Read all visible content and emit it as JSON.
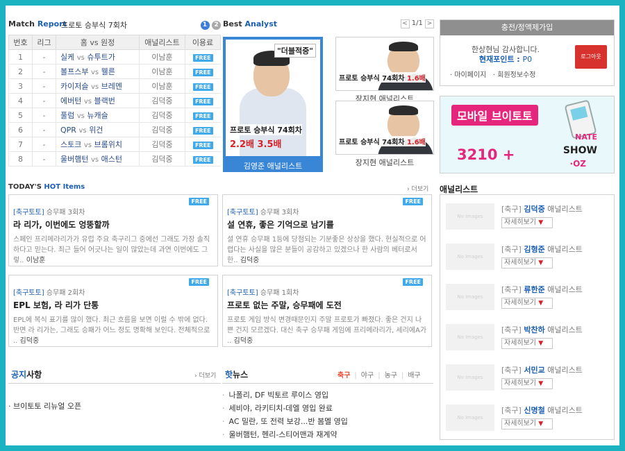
{
  "match_report": {
    "title_a": "Match",
    "title_b": "Report",
    "subtitle": "프로토 승부식 7회차",
    "pages": [
      "1",
      "2"
    ],
    "headers": [
      "번호",
      "리그",
      "홈 vs 원정",
      "애널리스트",
      "이용료"
    ],
    "rows": [
      {
        "no": "1",
        "league": "-",
        "home": "실케",
        "away": "슈투트가",
        "analyst": "이남훈",
        "fee": "FREE"
      },
      {
        "no": "2",
        "league": "-",
        "home": "볼프스부",
        "away": "웰른",
        "analyst": "이남훈",
        "fee": "FREE"
      },
      {
        "no": "3",
        "league": "-",
        "home": "카이저슬",
        "away": "브레멘",
        "analyst": "이남훈",
        "fee": "FREE"
      },
      {
        "no": "4",
        "league": "-",
        "home": "에버턴",
        "away": "블랙번",
        "analyst": "김덕중",
        "fee": "FREE"
      },
      {
        "no": "5",
        "league": "-",
        "home": "풀럼",
        "away": "뉴캐슬",
        "analyst": "김덕중",
        "fee": "FREE"
      },
      {
        "no": "6",
        "league": "-",
        "home": "QPR",
        "away": "위건",
        "analyst": "김덕중",
        "fee": "FREE"
      },
      {
        "no": "7",
        "league": "-",
        "home": "스토크",
        "away": "브롬위치",
        "analyst": "김덕중",
        "fee": "FREE"
      },
      {
        "no": "8",
        "league": "-",
        "home": "울버햄턴",
        "away": "애스턴",
        "analyst": "김덕중",
        "fee": "FREE"
      }
    ],
    "vs": "vs"
  },
  "best_analyst": {
    "title_a": "Best",
    "title_b": "Analyst",
    "pager": "1/1",
    "prev": "<",
    "next": ">",
    "featured": {
      "quote": "\"더블적중\"",
      "line1": "프로토 승부식 74회차",
      "line2": "2.2배 3.5배",
      "name": "김영준 애널리스트"
    },
    "small": [
      {
        "line": "프로토 승부식 74회차",
        "mult": "1.6배",
        "name": "장지현 애널리스트"
      },
      {
        "line": "프로토 승부식 74회차",
        "mult": "1.6배",
        "name": "장지현 애널리스트"
      }
    ]
  },
  "login": {
    "bar": "충전/정액제가입",
    "greeting": "한상현님 감사합니다.",
    "point_label": "현재포인트 : ",
    "point_value": "P0",
    "logout": "로그아웃",
    "link1": "· 마이페이지",
    "link2": "· 회원정보수정"
  },
  "mobile_banner": {
    "title": "모바일 브이토토",
    "number": "3210 +",
    "brand1": "NATE",
    "brand2": "SHOW",
    "brand3": "·OZ"
  },
  "analysts": {
    "title": "애널리스트",
    "noimg": "No Images",
    "more": "자세히보기",
    "items": [
      {
        "cat": "[축구]",
        "name": "김덕중",
        "role": "애널리스트"
      },
      {
        "cat": "[축구]",
        "name": "김형준",
        "role": "애널리스트"
      },
      {
        "cat": "[축구]",
        "name": "류한준",
        "role": "애널리스트"
      },
      {
        "cat": "[축구]",
        "name": "박찬하",
        "role": "애널리스트"
      },
      {
        "cat": "[축구]",
        "name": "서민교",
        "role": "애널리스트"
      },
      {
        "cat": "[축구]",
        "name": "신명철",
        "role": "애널리스트"
      }
    ]
  },
  "hot_items": {
    "title_a": "TODAY'S",
    "title_b": "HOT",
    "title_c": "Items",
    "more": "› 더보기",
    "cards": [
      {
        "cat": "[축구토토]",
        "sub": "승무패 3회차",
        "head": "라 리가, 이번에도 엉뚱할까",
        "body": "스페인 프리메라리가가 유럽 주요 축구리그 중에선 그래도 가장 솔직하다고 믿는다. 최근 들어 어긋나는 일이 많았는데 과연 이번에도 그렇..",
        "author": "이남훈",
        "fee": "FREE"
      },
      {
        "cat": "[축구토토]",
        "sub": "승무패 3회차",
        "head": "설 연휴, 좋은 기억으로 남기를",
        "body": "설 연휴 승무패 1등에 당첨되는 기분좋은 상상을 했다. 현실적으로 어렵다는 사실을 많은 분들이 공감하고 있겠으나 한 사람의 베터로서 한..",
        "author": "김덕중",
        "fee": "FREE"
      },
      {
        "cat": "[축구토토]",
        "sub": "승무패 2회차",
        "head": "EPL 보험, 라 리가 단통",
        "body": "EPL에 복식 표기를 많이 했다. 최근 흐름을 보면 이럴 수 밖에 없다. 반면 라 리가는, 그래도 승패가 어느 정도 명확해 보인다. 전체적으로 ..",
        "author": "김덕중",
        "fee": "FREE"
      },
      {
        "cat": "[축구토토]",
        "sub": "승무패 1회차",
        "head": "프로토 없는 주말, 승무패에 도전",
        "body": "프로토 게임 방식 변경때문인지 주말 프로토가 빠졌다. 좋은 건지 나쁜 건지 모르겠다. 대신 축구 승무패 게임에 프리메라리가, 세리에A가 ..",
        "author": "김덕중",
        "fee": "FREE"
      }
    ]
  },
  "notice": {
    "title_a": "공지",
    "title_b": "사항",
    "more": "› 더보기",
    "items": [
      "· 브이토토 리뉴얼 오픈"
    ]
  },
  "hot_news": {
    "title_a": "핫",
    "title_b": "뉴스",
    "tabs": [
      "축구",
      "야구",
      "농구",
      "배구"
    ],
    "items": [
      "나폴리, DF 빅토르 루이스 영입",
      "세비야, 라키티치-데엘 영입 완료",
      "AC 밀란, 또 전력 보강...반 봄멜 영입",
      "울버햄턴, 헨리-스티어맨과 재계약"
    ]
  }
}
